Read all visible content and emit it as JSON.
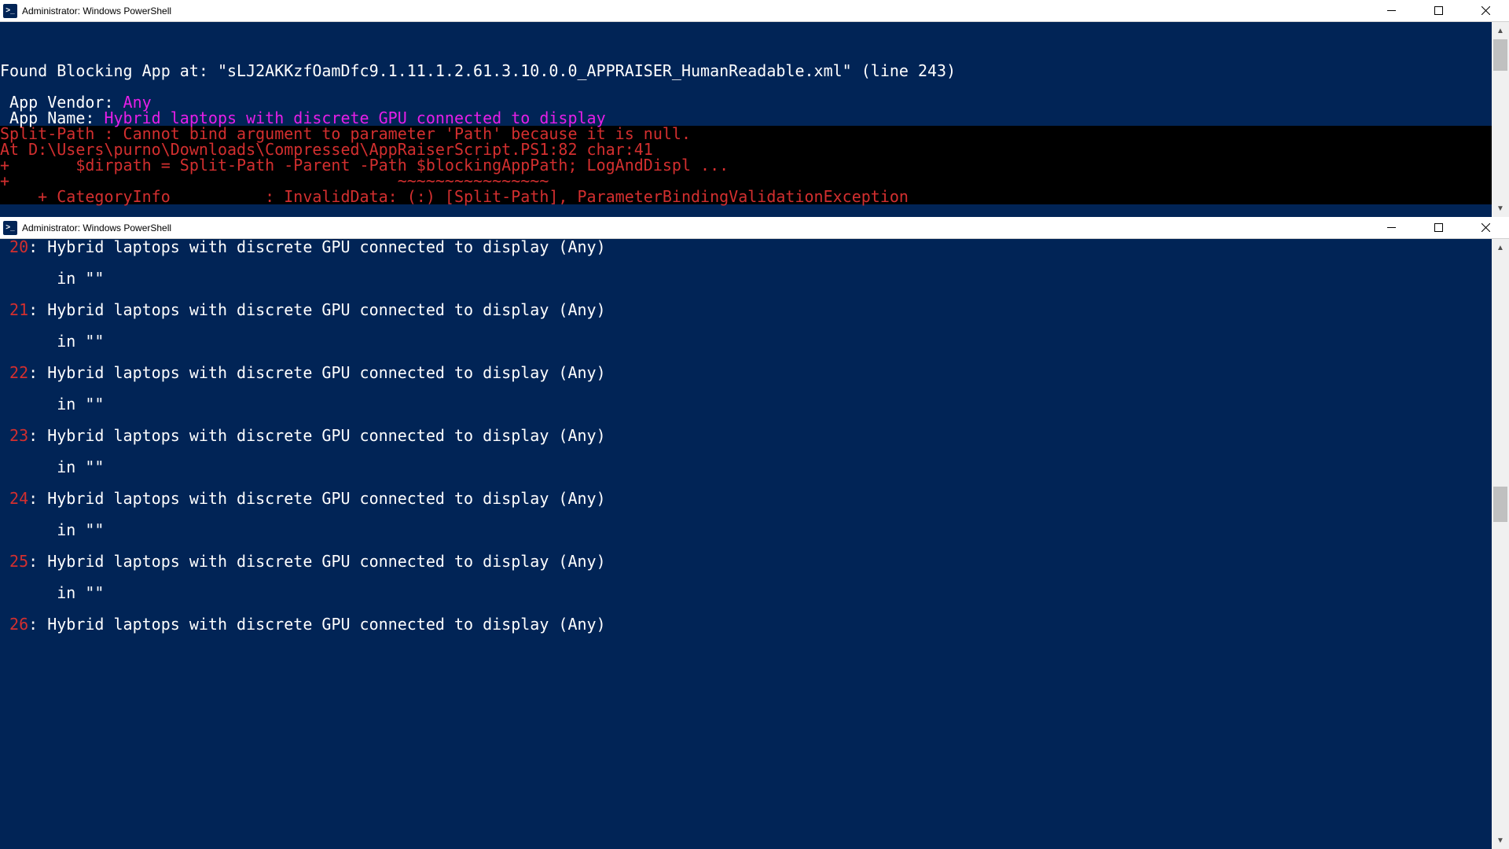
{
  "window_top": {
    "title": "Administrator: Windows PowerShell",
    "found_line": "Found Blocking App at: \"sLJ2AKKzfOamDfc9.1.11.1.2.61.3.10.0.0_APPRAISER_HumanReadable.xml\" (line 243)",
    "vendor_label": " App Vendor: ",
    "vendor_value": "Any",
    "name_label": " App Name: ",
    "name_value": "Hybrid laptops with discrete GPU connected to display",
    "err1": "Split-Path : Cannot bind argument to parameter 'Path' because it is null.",
    "err2": "At D:\\Users\\purno\\Downloads\\Compressed\\AppRaiserScript.PS1:82 char:41",
    "err3": "+       $dirpath = Split-Path -Parent -Path $blockingAppPath; LogAndDispl ...",
    "err4": "+                                         ~~~~~~~~~~~~~~~~",
    "err5": "    + CategoryInfo          : InvalidData: (:) [Split-Path], ParameterBindingValidationException"
  },
  "window_bot": {
    "title": "Administrator: Windows PowerShell",
    "entries": [
      {
        "idx": " 20",
        "text": ": Hybrid laptops with discrete GPU connected to display (Any)",
        "sub": "      in \"\""
      },
      {
        "idx": " 21",
        "text": ": Hybrid laptops with discrete GPU connected to display (Any)",
        "sub": "      in \"\""
      },
      {
        "idx": " 22",
        "text": ": Hybrid laptops with discrete GPU connected to display (Any)",
        "sub": "      in \"\""
      },
      {
        "idx": " 23",
        "text": ": Hybrid laptops with discrete GPU connected to display (Any)",
        "sub": "      in \"\""
      },
      {
        "idx": " 24",
        "text": ": Hybrid laptops with discrete GPU connected to display (Any)",
        "sub": "      in \"\""
      },
      {
        "idx": " 25",
        "text": ": Hybrid laptops with discrete GPU connected to display (Any)",
        "sub": "      in \"\""
      },
      {
        "idx": " 26",
        "text": ": Hybrid laptops with discrete GPU connected to display (Any)",
        "sub": ""
      }
    ]
  },
  "colors": {
    "console_bg": "#012456",
    "error_bg": "#000000",
    "error_fg": "#d32f2f",
    "magenta": "#e81ee8"
  }
}
